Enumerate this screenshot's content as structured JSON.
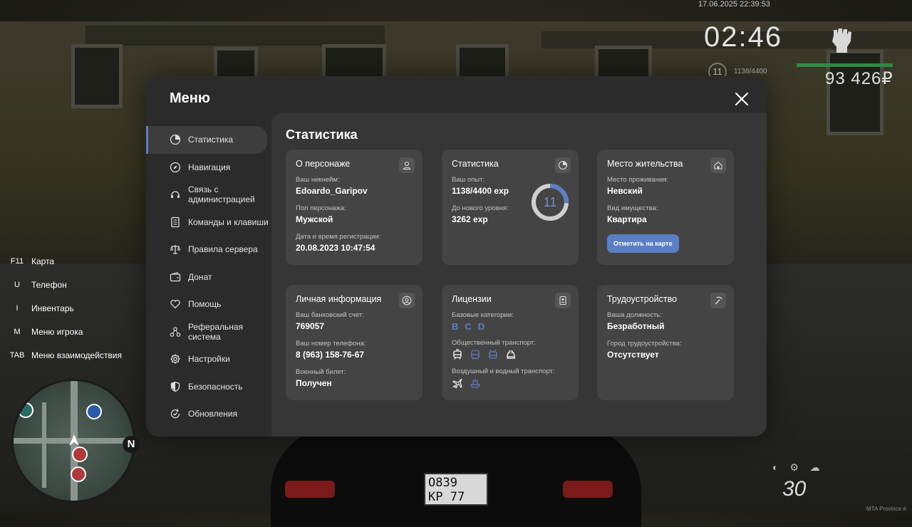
{
  "hud": {
    "datetime": "17.06.2025 22:39:53",
    "clock": "02:46",
    "level": "11",
    "exp": "1138/4400",
    "money": "93 426₽",
    "speed": "30",
    "watermark": "MTA Province #",
    "plate_top": "О839",
    "plate_bottom": "КР 77",
    "keybinds": [
      {
        "key": "F11",
        "label": "Карта"
      },
      {
        "key": "U",
        "label": "Телефон"
      },
      {
        "key": "I",
        "label": "Инвентарь"
      },
      {
        "key": "M",
        "label": "Меню игрока"
      },
      {
        "key": "TAB",
        "label": "Меню взаимодействия"
      }
    ],
    "compass": "N"
  },
  "menu": {
    "title": "Меню",
    "sidebar": [
      {
        "label": "Статистика",
        "icon": "pie-chart-icon",
        "active": true
      },
      {
        "label": "Навигация",
        "icon": "compass-icon"
      },
      {
        "label": "Связь с администрацией",
        "icon": "headset-icon"
      },
      {
        "label": "Команды и клавиши",
        "icon": "document-icon"
      },
      {
        "label": "Правила сервера",
        "icon": "scales-icon"
      },
      {
        "label": "Донат",
        "icon": "wallet-icon"
      },
      {
        "label": "Помощь",
        "icon": "heart-hands-icon"
      },
      {
        "label": "Реферальная система",
        "icon": "network-icon"
      },
      {
        "label": "Настройки",
        "icon": "gear-icon"
      },
      {
        "label": "Безопасность",
        "icon": "shield-icon"
      },
      {
        "label": "Обновления",
        "icon": "refresh-check-icon"
      }
    ],
    "content_title": "Статистика",
    "cards": {
      "character": {
        "title": "О персонаже",
        "nickname_label": "Ваш никнейм:",
        "nickname": "Edoardo_Garipov",
        "gender_label": "Пол персонажа:",
        "gender": "Мужской",
        "reg_label": "Дата и время регистрации:",
        "reg": "20.08.2023 10:47:54"
      },
      "stats": {
        "title": "Статистика",
        "exp_label": "Ваш опыт:",
        "exp": "1138/4400 exp",
        "next_label": "До нового уровня:",
        "next": "3262 exp",
        "level": "11",
        "progress": 0.2586
      },
      "residence": {
        "title": "Место жительства",
        "place_label": "Место проживания:",
        "place": "Невский",
        "type_label": "Вид имущества:",
        "type": "Квартира",
        "button": "Отметить на карте"
      },
      "personal": {
        "title": "Личная информация",
        "bank_label": "Ваш банковский счет:",
        "bank": "769057",
        "phone_label": "Ваш номер телефона:",
        "phone": "8 (963) 158-76-67",
        "military_label": "Военный билет:",
        "military": "Получен"
      },
      "licenses": {
        "title": "Лицензии",
        "base_label": "Базовые категории:",
        "categories": [
          "B",
          "C",
          "D"
        ],
        "public_label": "Общественный транспорт:",
        "air_label": "Воздушный и водный транспорт:"
      },
      "employment": {
        "title": "Трудоустройство",
        "position_label": "Ваша должность:",
        "position": "Безработный",
        "city_label": "Город трудоустройства:",
        "city": "Отсутствует"
      }
    }
  }
}
